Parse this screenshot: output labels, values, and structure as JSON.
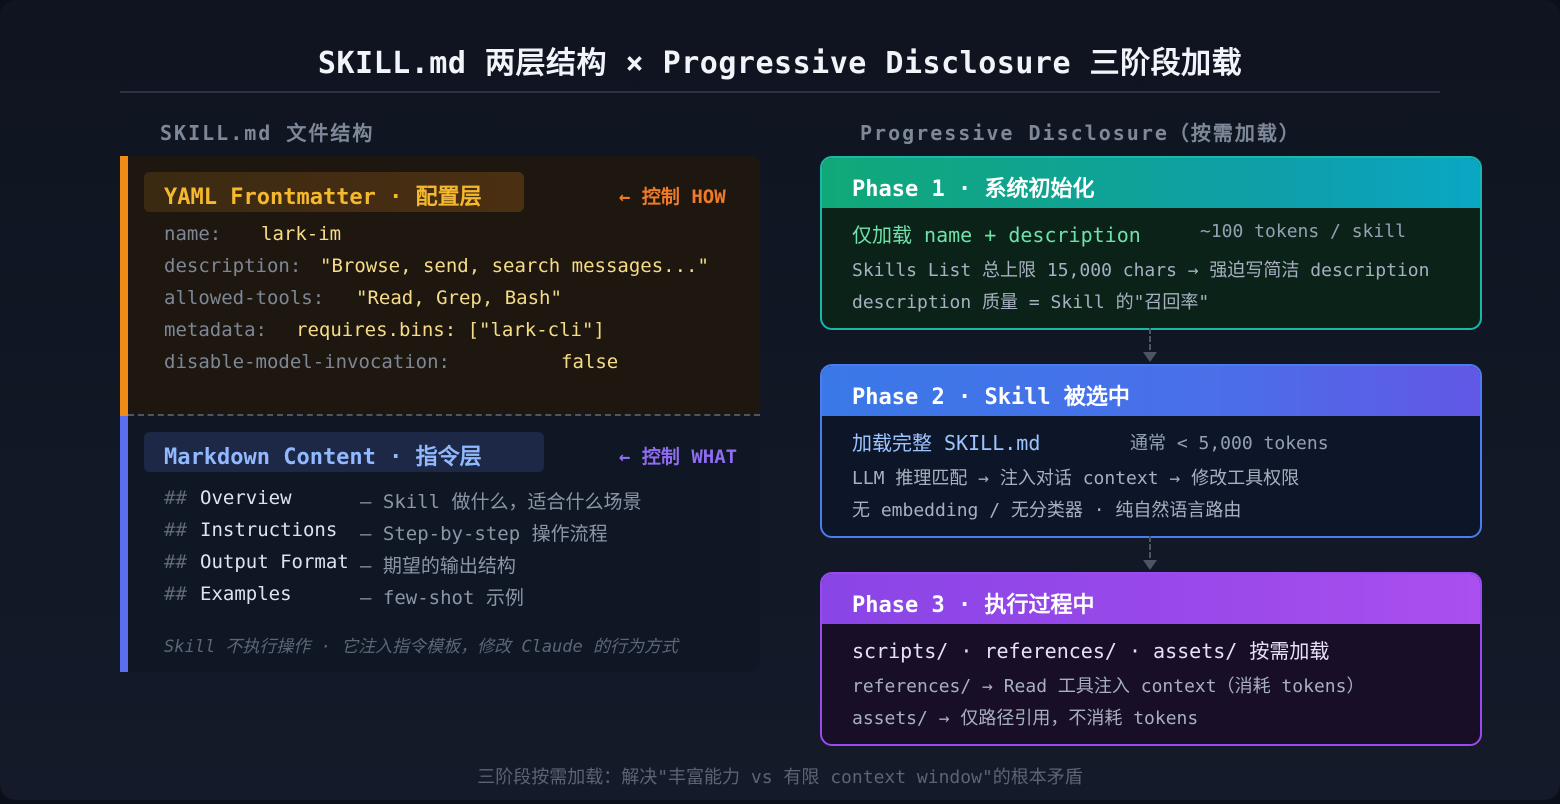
{
  "title": "SKILL.md 两层结构 × Progressive Disclosure 三阶段加载",
  "left": {
    "heading": "SKILL.md 文件结构",
    "yaml": {
      "badge": "YAML Frontmatter · 配置层",
      "control": "← 控制 HOW",
      "rows": [
        {
          "key": "name:",
          "value": "lark-im"
        },
        {
          "key": "description:",
          "value": "\"Browse, send, search messages...\""
        },
        {
          "key": "allowed-tools:",
          "value": "\"Read, Grep, Bash\""
        },
        {
          "key": "metadata:",
          "value": "requires.bins: [\"lark-cli\"]"
        },
        {
          "key": "disable-model-invocation:",
          "value": "false"
        }
      ]
    },
    "markdown": {
      "badge": "Markdown Content · 指令层",
      "control": "← 控制 WHAT",
      "rows": [
        {
          "hash": "##",
          "heading": "Overview",
          "desc": "— Skill 做什么，适合什么场景"
        },
        {
          "hash": "##",
          "heading": "Instructions",
          "desc": "— Step-by-step 操作流程"
        },
        {
          "hash": "##",
          "heading": "Output Format",
          "desc": "— 期望的输出结构"
        },
        {
          "hash": "##",
          "heading": "Examples",
          "desc": "— few-shot 示例"
        }
      ],
      "note": "Skill 不执行操作 · 它注入指令模板，修改 Claude 的行为方式"
    }
  },
  "right": {
    "heading": "Progressive Disclosure（按需加载）",
    "phases": [
      {
        "title": "Phase 1 · 系统初始化",
        "main": "仅加载 name + description",
        "side": "~100 tokens / skill",
        "lines": [
          "Skills List 总上限 15,000 chars → 强迫写简洁 description",
          "description 质量 = Skill 的\"召回率\""
        ]
      },
      {
        "title": "Phase 2 · Skill 被选中",
        "main": "加载完整 SKILL.md",
        "side": "通常 < 5,000 tokens",
        "lines": [
          "LLM 推理匹配 → 注入对话 context → 修改工具权限",
          "无 embedding / 无分类器 · 纯自然语言路由"
        ]
      },
      {
        "title": "Phase 3 · 执行过程中",
        "main": "scripts/ · references/ · assets/ 按需加载",
        "side": "",
        "lines": [
          "references/ → Read 工具注入 context（消耗 tokens）",
          "assets/ → 仅路径引用，不消耗 tokens"
        ]
      }
    ]
  },
  "footer": "三阶段按需加载：解决\"丰富能力 vs 有限 context window\"的根本矛盾",
  "colors": {
    "yaml_accent": "#f08c16",
    "md_accent": "#5b6ef0",
    "phase1": "#18b8aa",
    "phase2": "#4a7df0",
    "phase3": "#9a4bf0"
  }
}
